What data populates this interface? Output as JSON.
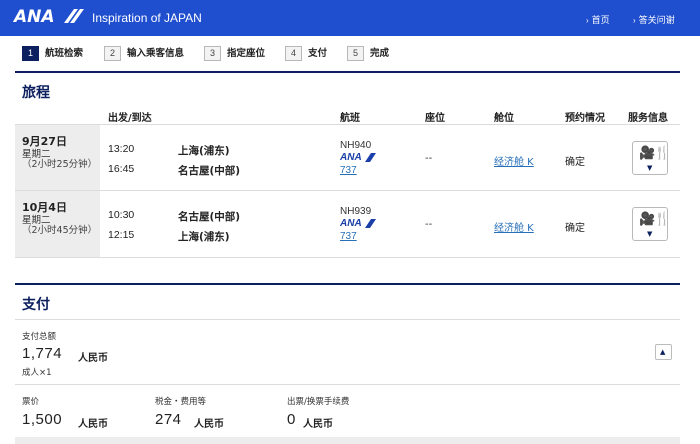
{
  "header": {
    "brand": "ANA",
    "tagline": "Inspiration of JAPAN",
    "home_link": "首页",
    "qa_link": "答关问谢"
  },
  "steps": [
    {
      "num": "1",
      "label": "航班检索",
      "active": true
    },
    {
      "num": "2",
      "label": "输入乘客信息",
      "active": false
    },
    {
      "num": "3",
      "label": "指定座位",
      "active": false
    },
    {
      "num": "4",
      "label": "支付",
      "active": false
    },
    {
      "num": "5",
      "label": "完成",
      "active": false
    }
  ],
  "itinerary": {
    "title": "旅程",
    "columns": {
      "dep_arr": "出发/到达",
      "flight": "航班",
      "seat": "座位",
      "cabin": "舱位",
      "booking": "预约情况",
      "service": "服务信息"
    },
    "segments": [
      {
        "date": "9月27日",
        "weekday": "星期二",
        "duration": "（2小时25分钟）",
        "dep_time": "13:20",
        "dep_city": "上海(浦东)",
        "arr_time": "16:45",
        "arr_city": "名古屋(中部)",
        "flight_no": "NH940",
        "airline": "ANA",
        "aircraft": "737",
        "seat": "--",
        "cabin": "经济舱 K",
        "status": "确定"
      },
      {
        "date": "10月4日",
        "weekday": "星期二",
        "duration": "（2小时45分钟）",
        "dep_time": "10:30",
        "dep_city": "名古屋(中部)",
        "arr_time": "12:15",
        "arr_city": "上海(浦东)",
        "flight_no": "NH939",
        "airline": "ANA",
        "aircraft": "737",
        "seat": "--",
        "cabin": "经济舱 K",
        "status": "确定"
      }
    ]
  },
  "payment": {
    "title": "支付",
    "total_label": "支付总额",
    "total_amount": "1,774",
    "total_currency": "人民币",
    "passengers": "成人×1",
    "fare_label": "票价",
    "fare_amount": "1,500",
    "fare_currency": "人民币",
    "tax_label": "税金・费用等",
    "tax_amount": "274",
    "tax_currency": "人民币",
    "fee_label": "出票/换票手续费",
    "fee_amount": "0",
    "fee_currency": "人民币"
  },
  "icons": {
    "service": "camera-and-cutlery-icon",
    "expand": "chevron-down-icon",
    "collapse": "triangle-up-icon"
  },
  "colors": {
    "header_bg": "#1f4fcf",
    "navy": "#0c1f5e",
    "link": "#2770b8"
  }
}
